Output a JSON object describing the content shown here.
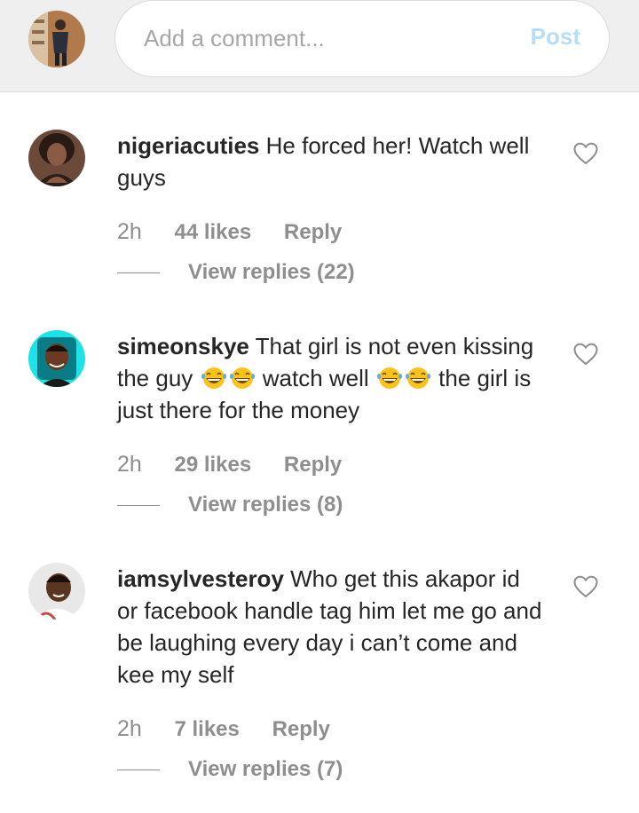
{
  "composer": {
    "placeholder": "Add a comment...",
    "post_label": "Post"
  },
  "comments": [
    {
      "username": "nigeriacuties",
      "text": "He forced her! Watch well guys",
      "time": "2h",
      "likes": "44 likes",
      "reply": "Reply",
      "replies": "View replies (22)"
    },
    {
      "username": "simeonskye",
      "text_1": "That girl is not even kissing the guy",
      "text_2": "watch well",
      "text_3": "the girl is just there for the money",
      "emoji": "grinning-squinting-face",
      "time": "2h",
      "likes": "29 likes",
      "reply": "Reply",
      "replies": "View replies (8)"
    },
    {
      "username": "iamsylvesteroy",
      "text": "Who get this akapor id or facebook handle tag him let me go and be laughing every day i can’t come and kee my self",
      "time": "2h",
      "likes": "7 likes",
      "reply": "Reply",
      "replies": "View replies (7)"
    }
  ],
  "colors": {
    "post_disabled": "#b9dcf8",
    "secondary_text": "#8e8e8e",
    "composer_bg": "#efefef"
  }
}
